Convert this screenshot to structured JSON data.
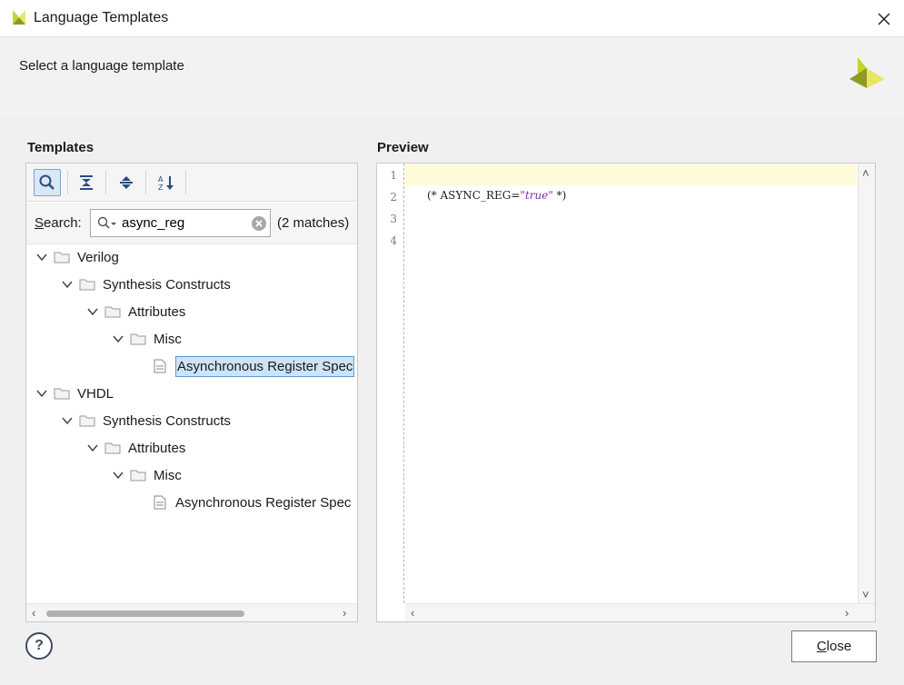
{
  "window": {
    "title": "Language Templates",
    "close_icon": "close-icon"
  },
  "banner": {
    "subtitle": "Select a language template"
  },
  "templates": {
    "label": "Templates",
    "toolbar": [
      "search-icon",
      "collapse-all-icon",
      "expand-all-icon",
      "sort-alpha-icon"
    ],
    "search": {
      "label": "Search:",
      "value": "async_reg",
      "placeholder": "",
      "matches": "(2 matches)"
    },
    "tree": [
      {
        "label": "Verilog",
        "type": "folder"
      },
      {
        "label": "Synthesis Constructs",
        "type": "folder"
      },
      {
        "label": "Attributes",
        "type": "folder"
      },
      {
        "label": "Misc",
        "type": "folder"
      },
      {
        "label": "Asynchronous Register Spec",
        "type": "file",
        "selected": true
      },
      {
        "label": "VHDL",
        "type": "folder"
      },
      {
        "label": "Synthesis Constructs",
        "type": "folder"
      },
      {
        "label": "Attributes",
        "type": "folder"
      },
      {
        "label": "Misc",
        "type": "folder"
      },
      {
        "label": "Asynchronous Register Spec",
        "type": "file",
        "selected": false
      }
    ]
  },
  "preview": {
    "label": "Preview",
    "line_numbers": [
      "1",
      "2",
      "3",
      "4"
    ],
    "code": {
      "prefix": "(* ASYNC_REG=",
      "value": "\"true\"",
      "suffix": " *)"
    }
  },
  "footer": {
    "help_label": "?",
    "close_label": "Close"
  },
  "colors": {
    "accent": "#5b9bd5",
    "selection": "#cde3f7",
    "highlight_line": "#fefbd8",
    "brand": "#9aa82a"
  }
}
